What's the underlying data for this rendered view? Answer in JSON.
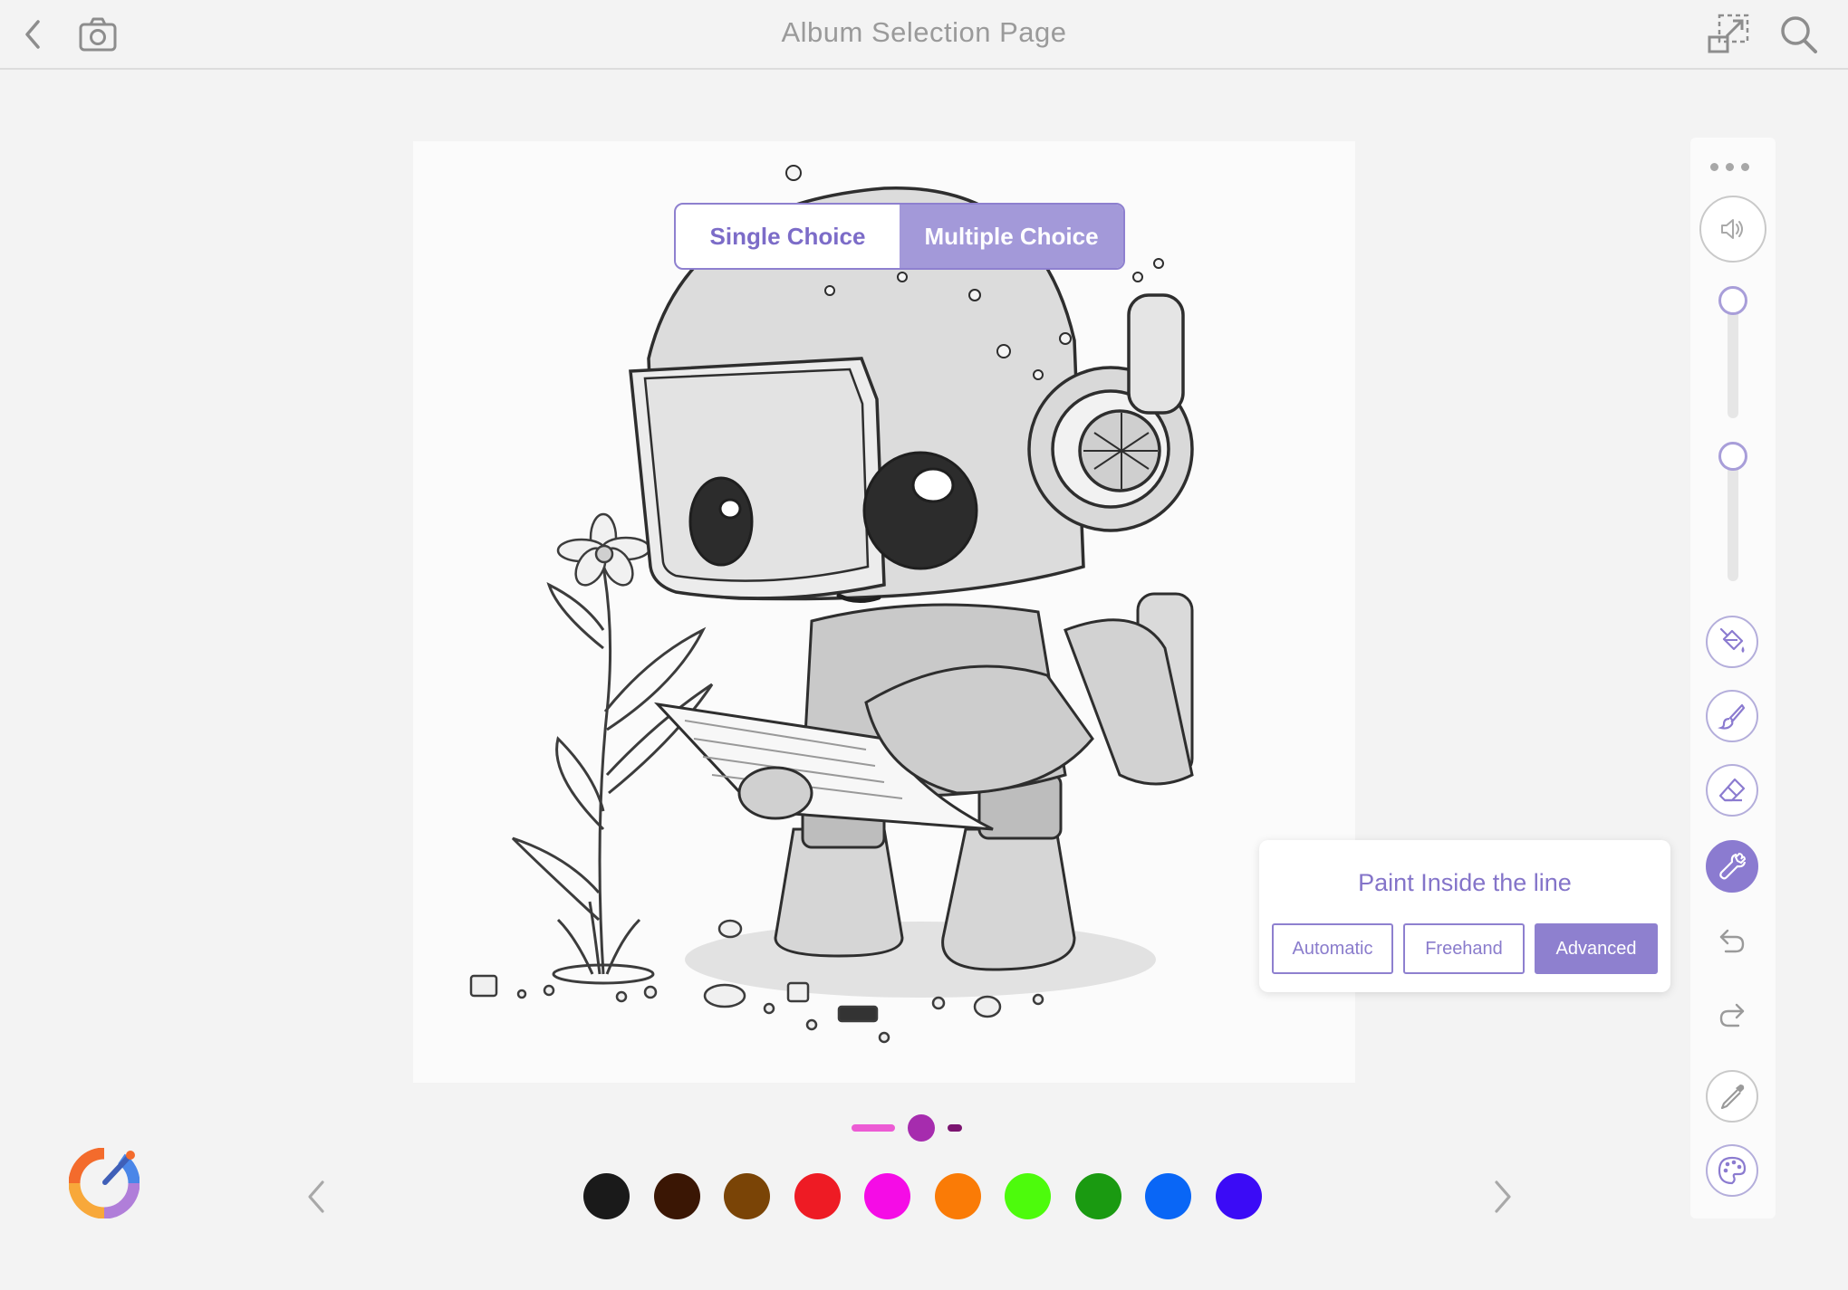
{
  "header": {
    "title": "Album Selection Page",
    "icons": [
      "back-icon",
      "camera-icon",
      "fullscreen-icon",
      "search-icon"
    ]
  },
  "choice": {
    "options": [
      "Single Choice",
      "Multiple Choice"
    ],
    "selected": "Multiple Choice"
  },
  "paint_inside": {
    "title": "Paint Inside the line",
    "options": [
      "Automatic",
      "Freehand",
      "Advanced"
    ],
    "selected": "Advanced"
  },
  "toolbar": {
    "tools": [
      "more-icon",
      "volume-icon",
      "bucket-icon",
      "brush-icon",
      "eraser-icon",
      "wrench-icon",
      "undo-icon",
      "redo-icon",
      "eyedropper-icon",
      "palette-icon"
    ],
    "active_tool": "wrench-icon",
    "accent": "#8b7bd0"
  },
  "palette": {
    "colors": [
      "#1a1a1a",
      "#3a1604",
      "#7a4406",
      "#ee1b24",
      "#f50ce6",
      "#fa7b06",
      "#4dfb0c",
      "#1a9a11",
      "#0966f6",
      "#3b0bf6"
    ],
    "brush_color": "#a62cae"
  }
}
